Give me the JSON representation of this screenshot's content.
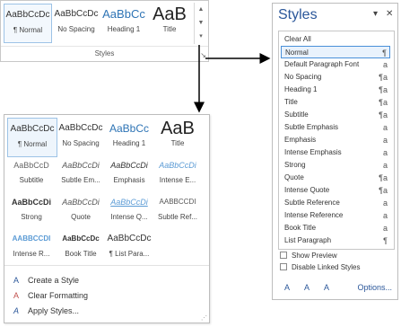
{
  "ribbon": {
    "tiles": [
      {
        "sample": "AaBbCcDc",
        "name": "¶ Normal"
      },
      {
        "sample": "AaBbCcDc",
        "name": "No Spacing"
      },
      {
        "sample": "AaBbCc",
        "name": "Heading 1"
      },
      {
        "sample": "AaB",
        "name": "Title"
      }
    ],
    "scroll_up": "▲",
    "scroll_down": "▼",
    "more": "▾",
    "group_label": "Styles",
    "launcher": "↘"
  },
  "gallery": {
    "tiles": [
      {
        "sample": "AaBbCcDc",
        "name": "¶ Normal"
      },
      {
        "sample": "AaBbCcDc",
        "name": "No Spacing"
      },
      {
        "sample": "AaBbCc",
        "name": "Heading 1"
      },
      {
        "sample": "AaB",
        "name": "Title"
      },
      {
        "sample": "AaBbCcD",
        "name": "Subtitle"
      },
      {
        "sample": "AaBbCcDi",
        "name": "Subtle Em..."
      },
      {
        "sample": "AaBbCcDi",
        "name": "Emphasis"
      },
      {
        "sample": "AaBbCcDi",
        "name": "Intense E..."
      },
      {
        "sample": "AaBbCcDi",
        "name": "Strong"
      },
      {
        "sample": "AaBbCcDi",
        "name": "Quote"
      },
      {
        "sample": "AaBbCcDi",
        "name": "Intense Q..."
      },
      {
        "sample": "AABBCCDI",
        "name": "Subtle Ref..."
      },
      {
        "sample": "AABBCCDI",
        "name": "Intense R..."
      },
      {
        "sample": "AaBbCcDc",
        "name": "Book Title"
      },
      {
        "sample": "AaBbCcDc",
        "name": "¶ List Para..."
      }
    ],
    "commands": [
      {
        "icon": "A",
        "label": "Create a Style"
      },
      {
        "icon": "A",
        "label": "Clear Formatting"
      },
      {
        "icon": "A",
        "label": "Apply Styles..."
      }
    ],
    "grip": "⋰"
  },
  "pane": {
    "title": "Styles",
    "menu": "▾",
    "close": "✕",
    "styles": [
      {
        "name": "Clear All",
        "mark": ""
      },
      {
        "name": "Normal",
        "mark": "¶"
      },
      {
        "name": "Default Paragraph Font",
        "mark": "a"
      },
      {
        "name": "No Spacing",
        "mark": "¶a"
      },
      {
        "name": "Heading 1",
        "mark": "¶a"
      },
      {
        "name": "Title",
        "mark": "¶a"
      },
      {
        "name": "Subtitle",
        "mark": "¶a"
      },
      {
        "name": "Subtle Emphasis",
        "mark": "a"
      },
      {
        "name": "Emphasis",
        "mark": "a"
      },
      {
        "name": "Intense Emphasis",
        "mark": "a"
      },
      {
        "name": "Strong",
        "mark": "a"
      },
      {
        "name": "Quote",
        "mark": "¶a"
      },
      {
        "name": "Intense Quote",
        "mark": "¶a"
      },
      {
        "name": "Subtle Reference",
        "mark": "a"
      },
      {
        "name": "Intense Reference",
        "mark": "a"
      },
      {
        "name": "Book Title",
        "mark": "a"
      },
      {
        "name": "List Paragraph",
        "mark": "¶"
      }
    ],
    "show_preview": "Show Preview",
    "disable_linked": "Disable Linked Styles",
    "btn_new": "A",
    "btn_inspect": "A",
    "btn_manage": "A",
    "options": "Options..."
  },
  "colors": {
    "accent": "#2b579a",
    "arrow": "#000000",
    "selected_border": "#4a90d9"
  }
}
